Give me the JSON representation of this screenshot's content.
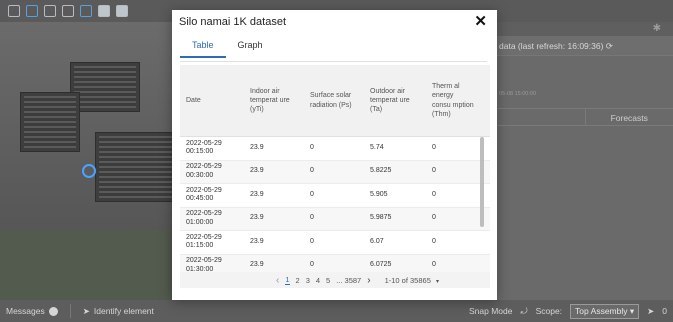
{
  "modal": {
    "title": "Silo namai 1K dataset",
    "close_icon": "close-icon",
    "tabs": [
      {
        "label": "Table",
        "active": true
      },
      {
        "label": "Graph",
        "active": false
      }
    ]
  },
  "table": {
    "columns": [
      "Date",
      "Indoor air temperat ure (yTi)",
      "Surface solar radiation (Ps)",
      "Outdoor air temperat ure (Ta)",
      "Therm al energy consu mption (Thm)"
    ],
    "rows": [
      {
        "date": "2022-05-29 00:15:00",
        "yti": "23.9",
        "ps": "0",
        "ta": "5.74",
        "thm": "0"
      },
      {
        "date": "2022-05-29 00:30:00",
        "yti": "23.9",
        "ps": "0",
        "ta": "5.8225",
        "thm": "0"
      },
      {
        "date": "2022-05-29 00:45:00",
        "yti": "23.9",
        "ps": "0",
        "ta": "5.905",
        "thm": "0"
      },
      {
        "date": "2022-05-29 01:00:00",
        "yti": "23.9",
        "ps": "0",
        "ta": "5.9875",
        "thm": "0"
      },
      {
        "date": "2022-05-29 01:15:00",
        "yti": "23.9",
        "ps": "0",
        "ta": "6.07",
        "thm": "0"
      },
      {
        "date": "2022-05-29 01:30:00",
        "yti": "23.9",
        "ps": "0",
        "ta": "6.0725",
        "thm": "0"
      }
    ]
  },
  "pager": {
    "prev": "‹",
    "pages": [
      "1",
      "2",
      "3",
      "4",
      "5"
    ],
    "ellipsis_last": "... 3587",
    "next": "›",
    "range": "1-10 of 35865",
    "caret": "▾"
  },
  "right_pane": {
    "refresh_text": "data (last refresh: 16:09:36)",
    "timestamp": "05-08 15:00:00",
    "tabs": [
      "",
      "Forecasts"
    ]
  },
  "status_bar": {
    "messages_label": "Messages",
    "identify_label": "Identify element",
    "snap_mode": "Snap Mode",
    "scope_label": "Scope:",
    "scope_value": "Top Assembly",
    "count": "0"
  },
  "colors": {
    "accent": "#2d6cb8",
    "overlay": "#4a4a4a"
  }
}
